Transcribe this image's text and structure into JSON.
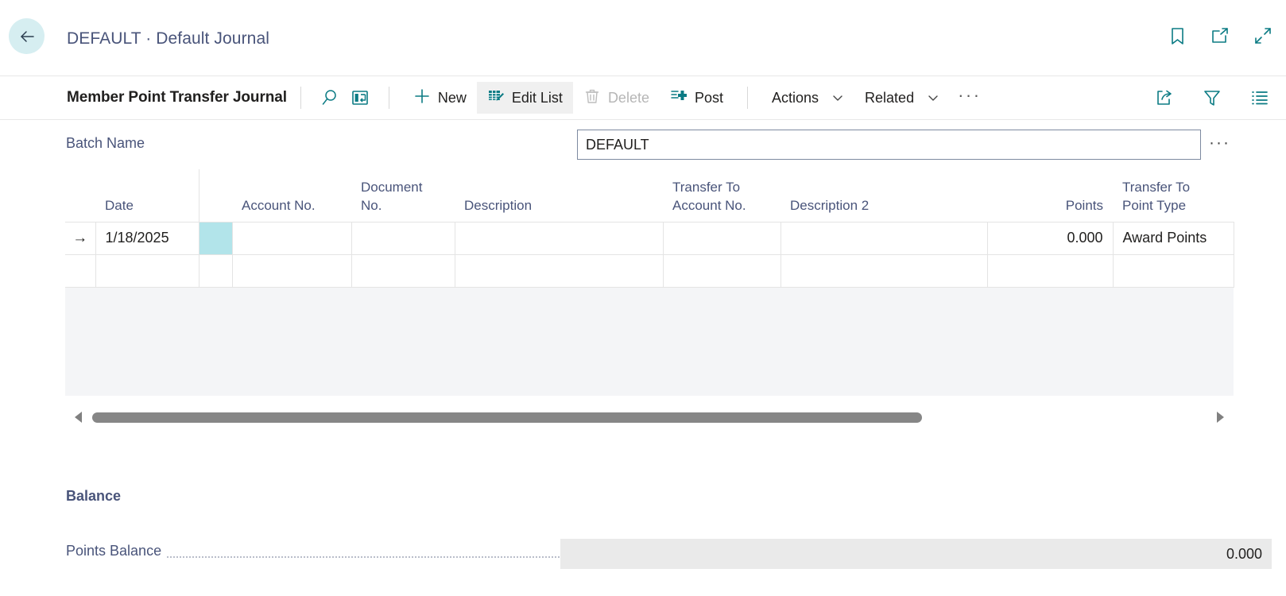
{
  "header": {
    "back_icon": "back-arrow-icon",
    "caption": "DEFAULT · Default Journal",
    "icons": [
      {
        "name": "bookmark-icon",
        "label": "Bookmark"
      },
      {
        "name": "open-in-new-window-icon",
        "label": "Open in new window"
      },
      {
        "name": "collapse-icon",
        "label": "Collapse"
      }
    ]
  },
  "commandbar": {
    "title": "Member Point Transfer Journal",
    "search_icon": "search-icon",
    "focus_icon": "focus-mode-icon",
    "new_label": "New",
    "edit_list_label": "Edit List",
    "delete_label": "Delete",
    "post_label": "Post",
    "actions_label": "Actions",
    "related_label": "Related",
    "more_label": "···",
    "share_icon": "share-icon",
    "filter_icon": "filter-icon",
    "list-pane_icon": "show-details-icon"
  },
  "batch": {
    "label": "Batch Name",
    "value": "DEFAULT",
    "placeholder": "",
    "lookup_label": "···"
  },
  "grid": {
    "columns": [
      {
        "key": "indicator",
        "header": ""
      },
      {
        "key": "date",
        "header": "Date",
        "align": "left"
      },
      {
        "key": "selected",
        "header": "",
        "align": "left"
      },
      {
        "key": "account_no",
        "header": "Account No.",
        "align": "left"
      },
      {
        "key": "document_no",
        "header": "Document No.",
        "align": "left"
      },
      {
        "key": "description",
        "header": "Description",
        "align": "left"
      },
      {
        "key": "transfer_to_account_no",
        "header": "Transfer To Account No.",
        "align": "left"
      },
      {
        "key": "description_2",
        "header": "Description 2",
        "align": "left"
      },
      {
        "key": "points",
        "header": "Points",
        "align": "right"
      },
      {
        "key": "transfer_to_point_type",
        "header": "Transfer To Point Type",
        "align": "left"
      }
    ],
    "rows": [
      {
        "indicator": "→",
        "date": "1/18/2025",
        "selected": "",
        "account_no": "",
        "document_no": "",
        "description": "",
        "transfer_to_account_no": "",
        "description_2": "",
        "points": "0.000",
        "transfer_to_point_type": "Award Points"
      },
      {
        "indicator": "",
        "date": "",
        "selected": "",
        "account_no": "",
        "document_no": "",
        "description": "",
        "transfer_to_account_no": "",
        "description_2": "",
        "points": "",
        "transfer_to_point_type": ""
      }
    ],
    "scroll_left_icon": "scroll-left-arrow-icon",
    "scroll_right_icon": "scroll-right-arrow-icon"
  },
  "balance": {
    "heading": "Balance",
    "points_balance_label": "Points Balance",
    "points_balance_value": "0.000"
  },
  "colors": {
    "accent_teal": "#0b7b84",
    "back_circle": "#d6eef1",
    "selected_cell": "#b2e4ea",
    "label_blue": "#49547a",
    "grid_empty_bg": "#f4f5f7",
    "readonly_field": "#eaeaea"
  }
}
